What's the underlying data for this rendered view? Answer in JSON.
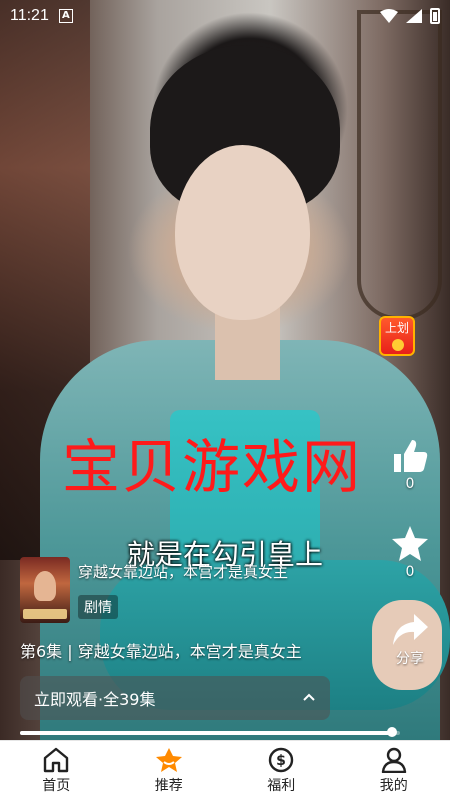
{
  "status_bar": {
    "time": "11:21",
    "notification_letter": "A"
  },
  "red_packet": {
    "label": "上划"
  },
  "watermark": "宝贝游戏网",
  "subtitle": "就是在勾引皇上",
  "actions": {
    "like": {
      "count": "0",
      "icon": "thumbs-up-icon"
    },
    "favorite": {
      "count": "0",
      "icon": "star-icon"
    },
    "share": {
      "label": "分享",
      "icon": "share-icon"
    }
  },
  "drama": {
    "title": "穿越女靠边站，本宫才是真女主",
    "tag": "剧情"
  },
  "episode_line": "第6集 | 穿越女靠边站，本宫才是真女主",
  "watch_bar": {
    "label": "立即观看·全39集"
  },
  "progress": {
    "fraction": 0.98
  },
  "bottom_nav": {
    "items": [
      {
        "label": "首页",
        "icon": "home-icon",
        "active": false
      },
      {
        "label": "推荐",
        "icon": "star-badge-icon",
        "active": true
      },
      {
        "label": "福利",
        "icon": "dollar-icon",
        "active": false
      },
      {
        "label": "我的",
        "icon": "person-icon",
        "active": false
      }
    ]
  },
  "colors": {
    "accent": "#ff8a00",
    "watermark": "#ff1a1a"
  }
}
